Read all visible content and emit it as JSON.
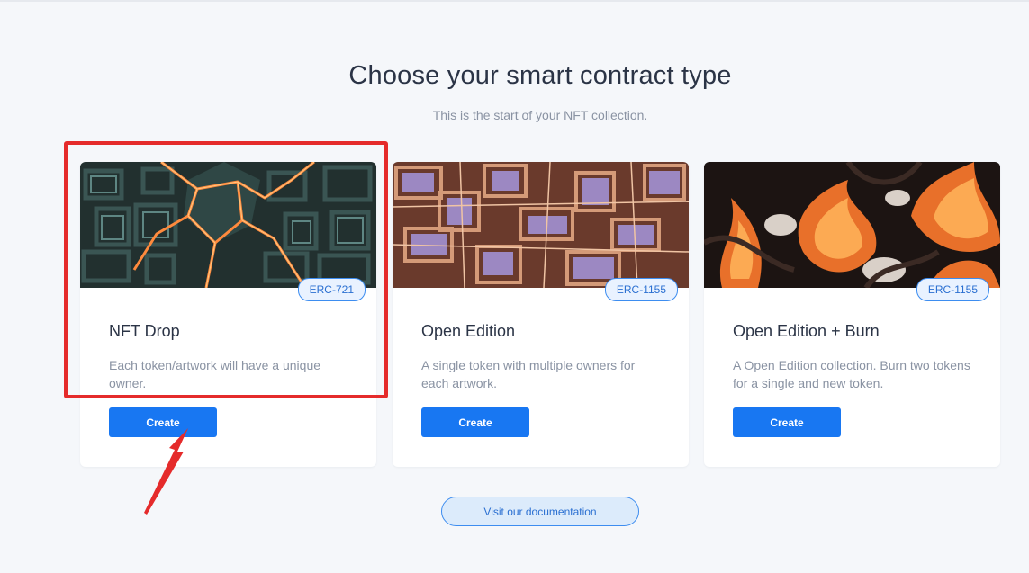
{
  "page": {
    "title": "Choose your smart contract type",
    "subtitle": "This is the start of your NFT collection."
  },
  "cards": [
    {
      "badge": "ERC-721",
      "title": "NFT Drop",
      "description": "Each token/artwork will have a unique owner.",
      "button_label": "Create",
      "image_theme": "dark-teal-maze-with-glowing-orange-cracks"
    },
    {
      "badge": "ERC-1155",
      "title": "Open Edition",
      "description": "A single token with multiple owners for each artwork.",
      "button_label": "Create",
      "image_theme": "copper-and-lavender-maze-pattern"
    },
    {
      "badge": "ERC-1155",
      "title": "Open Edition + Burn",
      "description": "A Open Edition collection. Burn two tokens for a single and new token.",
      "button_label": "Create",
      "image_theme": "flaming-orange-and-black-swirls"
    }
  ],
  "docs_button_label": "Visit our documentation",
  "colors": {
    "primary_button": "#1877f2",
    "badge_border": "#3d8df0",
    "annotation_red": "#e52b2b",
    "background": "#f5f7fa"
  }
}
